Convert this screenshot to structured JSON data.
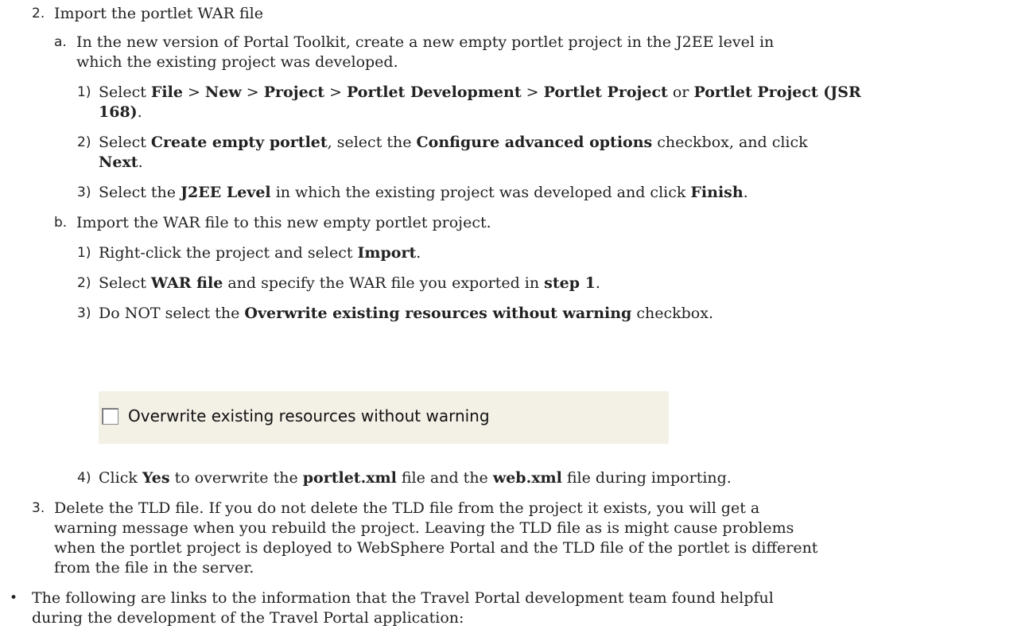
{
  "lines": [
    {
      "num": "2.",
      "text": [
        {
          "t": "Import the portlet WAR file"
        }
      ]
    },
    {
      "num": "a.",
      "text": [
        {
          "t": "In the new version of Portal Toolkit, create a new empty portlet project in the J2EE level in"
        }
      ]
    },
    {
      "num": "",
      "text": [
        {
          "t": "which the existing project was developed."
        }
      ]
    },
    {
      "num": "1)",
      "text": [
        {
          "t": "Select "
        },
        {
          "t": "File",
          "b": true
        },
        {
          "t": " > "
        },
        {
          "t": "New",
          "b": true
        },
        {
          "t": " > "
        },
        {
          "t": "Project",
          "b": true
        },
        {
          "t": " > "
        },
        {
          "t": "Portlet Development",
          "b": true
        },
        {
          "t": " > "
        },
        {
          "t": "Portlet Project",
          "b": true
        },
        {
          "t": " or "
        },
        {
          "t": "Portlet Project (JSR",
          "b": true
        }
      ]
    },
    {
      "num": "",
      "text": [
        {
          "t": "168)",
          "b": true
        },
        {
          "t": "."
        }
      ]
    },
    {
      "num": "2)",
      "text": [
        {
          "t": "Select "
        },
        {
          "t": "Create empty portlet",
          "b": true
        },
        {
          "t": ", select the "
        },
        {
          "t": "Configure advanced options",
          "b": true
        },
        {
          "t": " checkbox, and click"
        }
      ]
    },
    {
      "num": "",
      "text": [
        {
          "t": "Next",
          "b": true
        },
        {
          "t": "."
        }
      ]
    },
    {
      "num": "3)",
      "text": [
        {
          "t": "Select the "
        },
        {
          "t": "J2EE Level",
          "b": true
        },
        {
          "t": " in which the existing project was developed and click "
        },
        {
          "t": "Finish",
          "b": true
        },
        {
          "t": "."
        }
      ]
    },
    {
      "num": "b.",
      "text": [
        {
          "t": "Import the WAR file to this new empty portlet project."
        }
      ]
    },
    {
      "num": "1)",
      "text": [
        {
          "t": "Right-click the project and select "
        },
        {
          "t": "Import",
          "b": true
        },
        {
          "t": "."
        }
      ]
    },
    {
      "num": "2)",
      "text": [
        {
          "t": "Select "
        },
        {
          "t": "WAR file",
          "b": true
        },
        {
          "t": " and specify the WAR file you exported in "
        },
        {
          "t": "step 1",
          "b": true
        },
        {
          "t": "."
        }
      ]
    },
    {
      "num": "3)",
      "text": [
        {
          "t": "Do NOT select the "
        },
        {
          "t": "Overwrite existing resources without warning",
          "b": true
        },
        {
          "t": " checkbox."
        }
      ]
    },
    {
      "num": "4)",
      "text": [
        {
          "t": "Click "
        },
        {
          "t": "Yes",
          "b": true
        },
        {
          "t": " to overwrite the "
        },
        {
          "t": "portlet.xml",
          "b": true
        },
        {
          "t": " file and the "
        },
        {
          "t": "web.xml",
          "b": true
        },
        {
          "t": " file during importing."
        }
      ]
    },
    {
      "num": "3.",
      "text": [
        {
          "t": "Delete the TLD file. If you do not delete the TLD file from the project it exists, you will get a"
        }
      ]
    },
    {
      "num": "",
      "text": [
        {
          "t": "warning message when you rebuild the project. Leaving the TLD file as is  might cause problems"
        }
      ]
    },
    {
      "num": "",
      "text": [
        {
          "t": "when the portlet project is deployed to WebSphere Portal and the TLD file of the portlet is different"
        }
      ]
    },
    {
      "num": "",
      "text": [
        {
          "t": "from the file in the server."
        }
      ]
    },
    {
      "num": "•",
      "text": [
        {
          "t": "The following are links to the information that the Travel Portal development team found helpful"
        }
      ]
    },
    {
      "num": "",
      "text": [
        {
          "t": "during the development of the Travel Portal application:"
        }
      ]
    }
  ],
  "checkbox": {
    "label": "Overwrite existing resources without warning",
    "checked": false
  }
}
